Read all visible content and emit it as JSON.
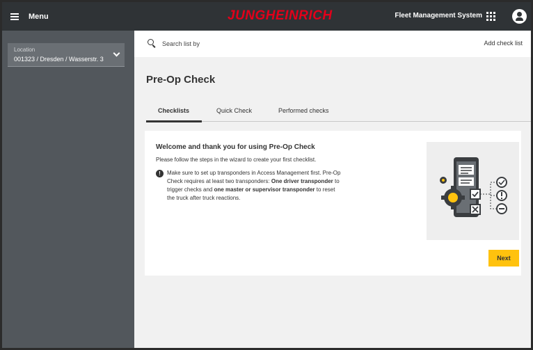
{
  "topbar": {
    "menu_label": "Menu",
    "brand": "JUNGHEINRICH",
    "app_name": "Fleet Management System"
  },
  "sidebar": {
    "location_label": "Location",
    "location_value": "001323 / Dresden / Wasserstr. 3"
  },
  "search": {
    "placeholder": "Search list by",
    "add_label": "Add check list"
  },
  "main": {
    "title": "Pre-Op Check",
    "tabs": [
      {
        "label": "Checklists",
        "active": true
      },
      {
        "label": "Quick Check",
        "active": false
      },
      {
        "label": "Performed checks",
        "active": false
      }
    ]
  },
  "card": {
    "heading": "Welcome and thank you for using Pre-Op Check",
    "instruction": "Please follow the steps in the wizard to create your first checklist.",
    "note_part1": "Make sure to set up transponders in Access Management first. Pre-Op Check requires at least two transponders: ",
    "note_bold1": "One driver transponder",
    "note_part2": " to trigger checks and ",
    "note_bold2": "one master or supervisor transponder",
    "note_part3": " to reset the truck after truck reactions.",
    "next_label": "Next"
  },
  "colors": {
    "topbar": "#2f3336",
    "sidebar": "#52575c",
    "brand_red": "#e2001a",
    "accent_yellow": "#ffc20e"
  }
}
